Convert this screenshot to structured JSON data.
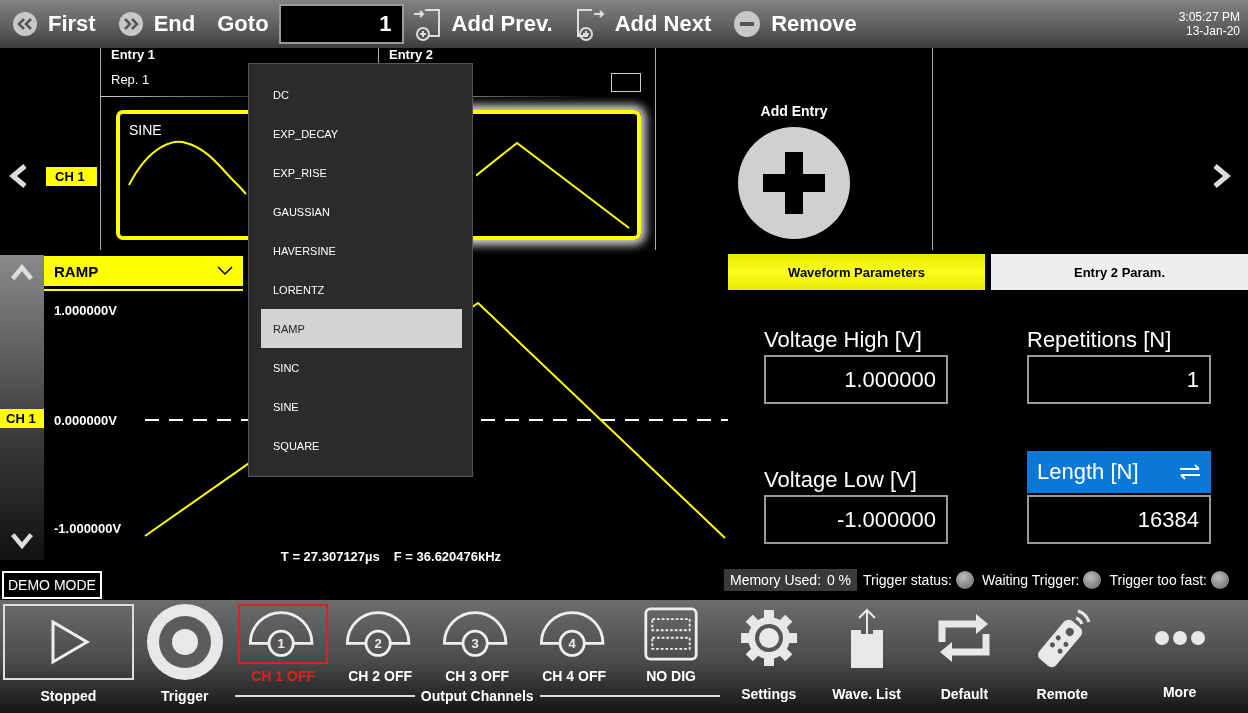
{
  "toolbar": {
    "buttons": [
      {
        "kind": "first",
        "label": "First"
      },
      {
        "kind": "end",
        "label": "End"
      }
    ],
    "goto": {
      "label": "Goto",
      "value": "1"
    },
    "actions": [
      {
        "kind": "add_prev",
        "label": "Add Prev."
      },
      {
        "kind": "add_next",
        "label": "Add Next"
      },
      {
        "kind": "remove",
        "label": "Remove"
      }
    ],
    "clock": {
      "time": "3:05:27 PM",
      "date": "13-Jan-20"
    }
  },
  "sequence": {
    "channel_label": "CH 1",
    "entries": [
      {
        "title": "Entry 1",
        "repetitions": "Rep. 1",
        "waveform_label": "SINE",
        "kind": "sine",
        "selected": false
      },
      {
        "title": "Entry 2",
        "kind": "triangle",
        "selected": true
      }
    ],
    "add_entry": {
      "label": "Add Entry"
    }
  },
  "waveform_select": {
    "value": "RAMP",
    "expanded": true,
    "options": [
      {
        "label": "DC",
        "selected": false
      },
      {
        "label": "EXP_DECAY",
        "selected": false
      },
      {
        "label": "EXP_RISE",
        "selected": false
      },
      {
        "label": "GAUSSIAN",
        "selected": false
      },
      {
        "label": "HAVERSINE",
        "selected": false
      },
      {
        "label": "LORENTZ",
        "selected": false
      },
      {
        "label": "RAMP",
        "selected": true
      },
      {
        "label": "SINC",
        "selected": false
      },
      {
        "label": "SINE",
        "selected": false
      },
      {
        "label": "SQUARE",
        "selected": false
      }
    ]
  },
  "plot": {
    "channel_label": "CH 1",
    "levels": [
      "1.000000V",
      "0.000000V",
      "-1.000000V"
    ],
    "period": "T =  27.307127µs",
    "frequency": "F =  36.620476kHz"
  },
  "parameters": {
    "tabs": [
      {
        "label": "Waveform Parameters",
        "selected": true
      },
      {
        "label": "Entry  2  Param.",
        "selected": false
      }
    ],
    "fields": [
      {
        "label": "Voltage High [V]",
        "value": "1.000000",
        "kind": "plain"
      },
      {
        "label": "Repetitions [N]",
        "value": "1",
        "kind": "plain"
      },
      {
        "label": "Voltage Low [V]",
        "value": "-1.000000",
        "kind": "plain"
      },
      {
        "label": "Length [N]",
        "value": "16384",
        "kind": "toggle"
      }
    ]
  },
  "status": {
    "demo_mode": "DEMO MODE",
    "memory": {
      "label": "Memory Used:",
      "value": "0 %"
    },
    "indicators": [
      {
        "label": "Trigger status:",
        "on": false
      },
      {
        "label": "Waiting Trigger:",
        "on": false
      },
      {
        "label": "Trigger too fast:",
        "on": false
      }
    ]
  },
  "bottom_bar": {
    "run": {
      "label": "Stopped"
    },
    "trigger": {
      "label": "Trigger"
    },
    "channels": [
      {
        "number": "1",
        "label": "CH 1 OFF",
        "selected": true
      },
      {
        "number": "2",
        "label": "CH 2 OFF",
        "selected": false
      },
      {
        "number": "3",
        "label": "CH 3 OFF",
        "selected": false
      },
      {
        "number": "4",
        "label": "CH 4 OFF",
        "selected": false
      }
    ],
    "digital": {
      "label": "NO DIG"
    },
    "group_label": "Output Channels",
    "tools": [
      {
        "kind": "settings",
        "label": "Settings"
      },
      {
        "kind": "wave_list",
        "label": "Wave. List"
      },
      {
        "kind": "default",
        "label": "Default"
      },
      {
        "kind": "remote",
        "label": "Remote"
      },
      {
        "kind": "more",
        "label": "More"
      }
    ]
  }
}
